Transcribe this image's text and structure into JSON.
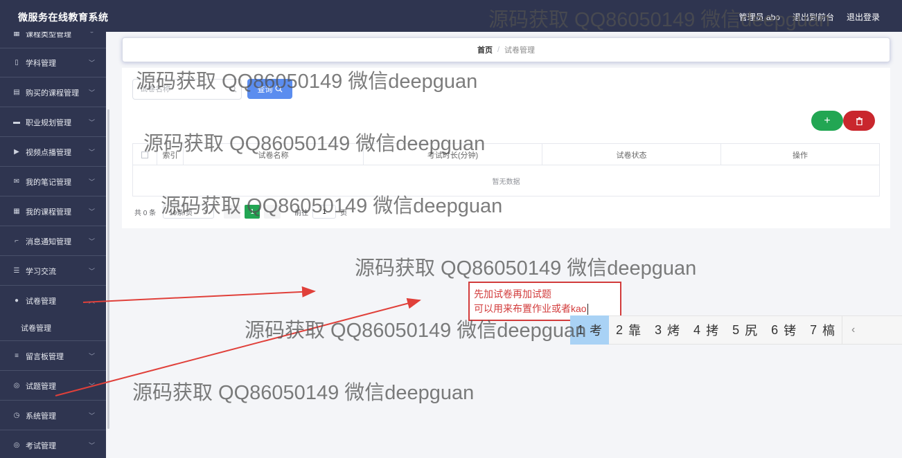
{
  "app": {
    "title": "微服务在线教育系统"
  },
  "topnav": {
    "user": "管理员 abo",
    "frontend": "退出到前台",
    "logout": "退出登录"
  },
  "sidebar": {
    "items": [
      {
        "label": "课程类型管理",
        "icon": "grid-icon"
      },
      {
        "label": "学科管理",
        "icon": "book-icon"
      },
      {
        "label": "购买的课程管理",
        "icon": "clipboard-icon"
      },
      {
        "label": "职业规划管理",
        "icon": "monitor-icon"
      },
      {
        "label": "视频点播管理",
        "icon": "video-icon"
      },
      {
        "label": "我的笔记管理",
        "icon": "mail-icon"
      },
      {
        "label": "我的课程管理",
        "icon": "grid-icon"
      },
      {
        "label": "消息通知管理",
        "icon": "crop-icon"
      },
      {
        "label": "学习交流",
        "icon": "sliders-icon"
      },
      {
        "label": "试卷管理",
        "icon": "user-icon"
      },
      {
        "label": "留言板管理",
        "icon": "list-icon"
      },
      {
        "label": "试题管理",
        "icon": "compass-icon"
      },
      {
        "label": "系统管理",
        "icon": "clock-icon"
      },
      {
        "label": "考试管理",
        "icon": "compass-icon"
      }
    ],
    "sub_item": "试卷管理"
  },
  "breadcrumb": {
    "home": "首页",
    "separator": "/",
    "current": "试卷管理"
  },
  "search": {
    "placeholder": "试卷名称",
    "button": "查询"
  },
  "table": {
    "columns": [
      "索引",
      "试卷名称",
      "考试时长(分钟)",
      "试卷状态",
      "操作"
    ],
    "empty_text": "暂无数据"
  },
  "pagination": {
    "total": "共 0 条",
    "page_size": "10条/页",
    "current_page": "1",
    "goto_prefix": "前往",
    "goto_value": "1",
    "goto_suffix": "页"
  },
  "annotation": {
    "line1": "先加试卷再加试题",
    "line2": "可以用来布置作业或者kao"
  },
  "ime": {
    "candidates": [
      {
        "num": "1",
        "char": "考"
      },
      {
        "num": "2",
        "char": "靠"
      },
      {
        "num": "3",
        "char": "烤"
      },
      {
        "num": "4",
        "char": "拷"
      },
      {
        "num": "5",
        "char": "尻"
      },
      {
        "num": "6",
        "char": "铐"
      },
      {
        "num": "7",
        "char": "槁"
      }
    ]
  },
  "watermark": "源码获取 QQ86050149 微信deepguan",
  "colors": {
    "nav_bg": "#2f3550",
    "primary": "#5b8def",
    "success": "#22a653",
    "danger": "#c9272d",
    "annotation": "#d23b3b"
  }
}
